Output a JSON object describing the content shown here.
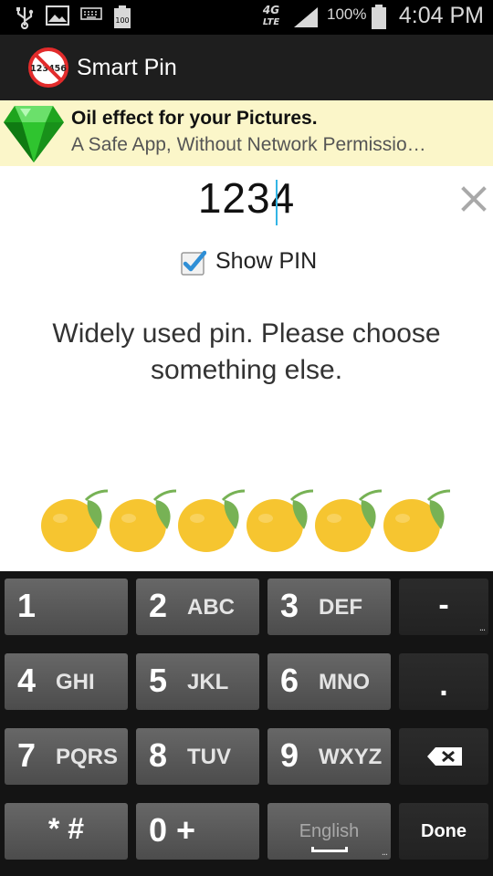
{
  "status_bar": {
    "network": "4G LTE",
    "battery_percent": "100%",
    "time": "4:04 PM",
    "icons": [
      "usb-icon",
      "image-icon",
      "keyboard-icon",
      "battery-full-small-icon",
      "lte-icon",
      "signal-icon",
      "battery-icon"
    ]
  },
  "action_bar": {
    "title": "Smart Pin",
    "logo_text": "123456",
    "logo_icon": "no-pin-icon"
  },
  "ad": {
    "title": "Oil effect for your Pictures.",
    "subtitle": "A Safe App, Without Network Permissio…",
    "icon": "green-gem-icon"
  },
  "pin_field": {
    "value": "1234",
    "clear_icon": "close-icon"
  },
  "show_pin": {
    "label": "Show PIN",
    "checked": true
  },
  "message": "Widely used pin. Please choose something else.",
  "rating": {
    "icon": "lemon-icon",
    "count": 6
  },
  "keyboard": {
    "rows": [
      [
        {
          "num": "1",
          "letters": ""
        },
        {
          "num": "2",
          "letters": "ABC"
        },
        {
          "num": "3",
          "letters": "DEF"
        },
        {
          "label": "-",
          "style": "dark"
        }
      ],
      [
        {
          "num": "4",
          "letters": "GHI"
        },
        {
          "num": "5",
          "letters": "JKL"
        },
        {
          "num": "6",
          "letters": "MNO"
        },
        {
          "label": ".",
          "style": "dark"
        }
      ],
      [
        {
          "num": "7",
          "letters": "PQRS"
        },
        {
          "num": "8",
          "letters": "TUV"
        },
        {
          "num": "9",
          "letters": "WXYZ"
        },
        {
          "icon": "backspace-icon",
          "style": "dark"
        }
      ],
      [
        {
          "label": "* #"
        },
        {
          "label": "0 +"
        },
        {
          "label": "English"
        },
        {
          "label": "Done",
          "style": "dark"
        }
      ]
    ]
  },
  "colors": {
    "accent": "#33b5e5",
    "ad_background": "#fbf6c9",
    "keyboard_background": "#141414",
    "lemon": "#f6c530",
    "leaf": "#77b255"
  }
}
